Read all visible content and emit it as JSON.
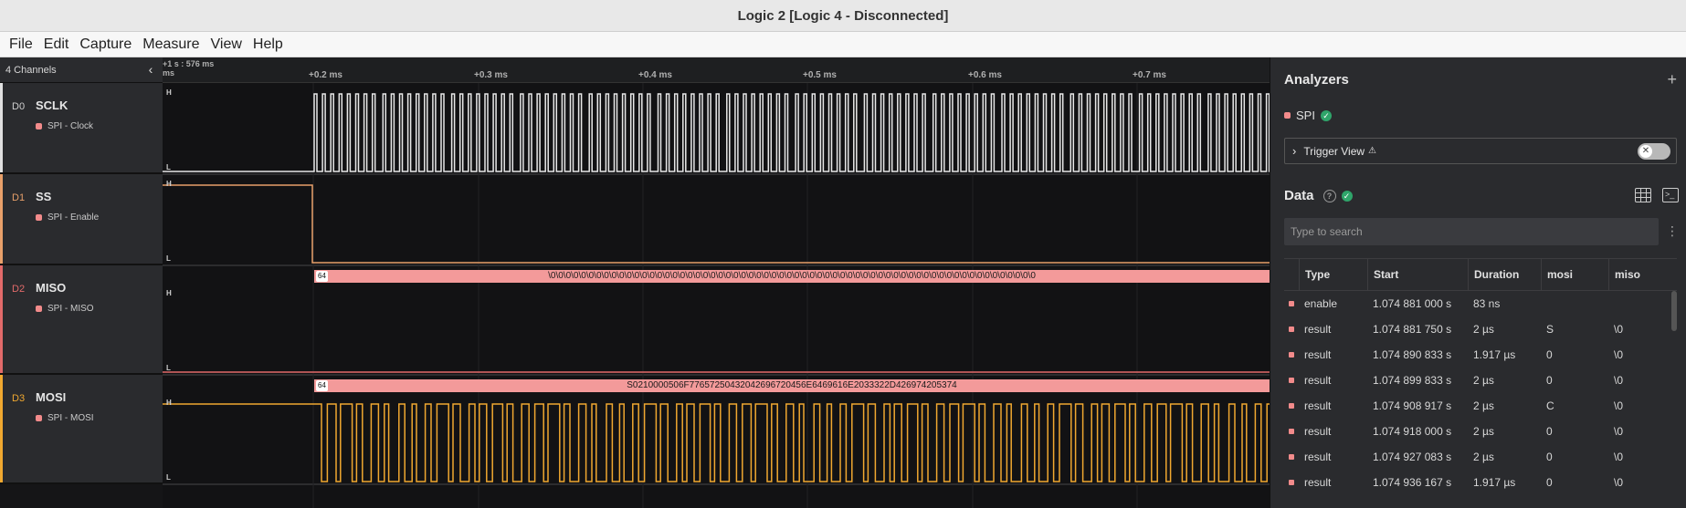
{
  "window": {
    "title": "Logic 2 [Logic 4 - Disconnected]"
  },
  "menu": [
    "File",
    "Edit",
    "Capture",
    "Measure",
    "View",
    "Help"
  ],
  "channels_header": {
    "label": "4 Channels"
  },
  "channels": [
    {
      "id": "D0",
      "name": "SCLK",
      "analyzer": "SPI - Clock",
      "color": "#e0e0e0"
    },
    {
      "id": "D1",
      "name": "SS",
      "analyzer": "SPI - Enable",
      "color": "#e8a06a"
    },
    {
      "id": "D2",
      "name": "MISO",
      "analyzer": "SPI - MISO",
      "color": "#e26a6a"
    },
    {
      "id": "D3",
      "name": "MOSI",
      "analyzer": "SPI - MOSI",
      "color": "#f0a830"
    }
  ],
  "ruler": {
    "left_label": "+1 s : 576 ms",
    "left_unit": "ms",
    "ticks": [
      "+0.2 ms",
      "+0.3 ms",
      "+0.4 ms",
      "+0.5 ms",
      "+0.6 ms",
      "+0.7 ms"
    ]
  },
  "waves": {
    "level_high": "H",
    "level_low": "L",
    "miso_badge": "64",
    "miso_decoded": "\\0\\0\\0\\0\\0\\0\\0\\0\\0\\0\\0\\0\\0\\0\\0\\0\\0\\0\\0\\0\\0\\0\\0\\0\\0\\0\\0\\0\\0\\0\\0\\0\\0\\0\\0\\0\\0\\0\\0\\0\\0\\0\\0\\0\\0\\0\\0\\0\\0\\0\\0\\0\\0\\0\\0\\0\\0\\0\\0\\0\\0\\0\\0\\0",
    "mosi_badge": "64",
    "mosi_decoded": "S0210000506F77657250432042696720456E6469616E2033322D426974205374"
  },
  "analyzers_panel": {
    "title": "Analyzers",
    "analyzer_name": "SPI",
    "trigger_view_label": "Trigger View"
  },
  "data_panel": {
    "title": "Data",
    "help": "?",
    "search_placeholder": "Type to search",
    "columns": [
      "Type",
      "Start",
      "Duration",
      "mosi",
      "miso"
    ],
    "rows": [
      {
        "type": "enable",
        "start": "1.074 881 000 s",
        "duration": "83 ns",
        "mosi": "",
        "miso": ""
      },
      {
        "type": "result",
        "start": "1.074 881 750 s",
        "duration": "2 µs",
        "mosi": "S",
        "miso": "\\0"
      },
      {
        "type": "result",
        "start": "1.074 890 833 s",
        "duration": "1.917 µs",
        "mosi": "0",
        "miso": "\\0"
      },
      {
        "type": "result",
        "start": "1.074 899 833 s",
        "duration": "2 µs",
        "mosi": "0",
        "miso": "\\0"
      },
      {
        "type": "result",
        "start": "1.074 908 917 s",
        "duration": "2 µs",
        "mosi": "C",
        "miso": "\\0"
      },
      {
        "type": "result",
        "start": "1.074 918 000 s",
        "duration": "2 µs",
        "mosi": "0",
        "miso": "\\0"
      },
      {
        "type": "result",
        "start": "1.074 927 083 s",
        "duration": "2 µs",
        "mosi": "0",
        "miso": "\\0"
      },
      {
        "type": "result",
        "start": "1.074 936 167 s",
        "duration": "1.917 µs",
        "mosi": "0",
        "miso": "\\0"
      }
    ]
  }
}
